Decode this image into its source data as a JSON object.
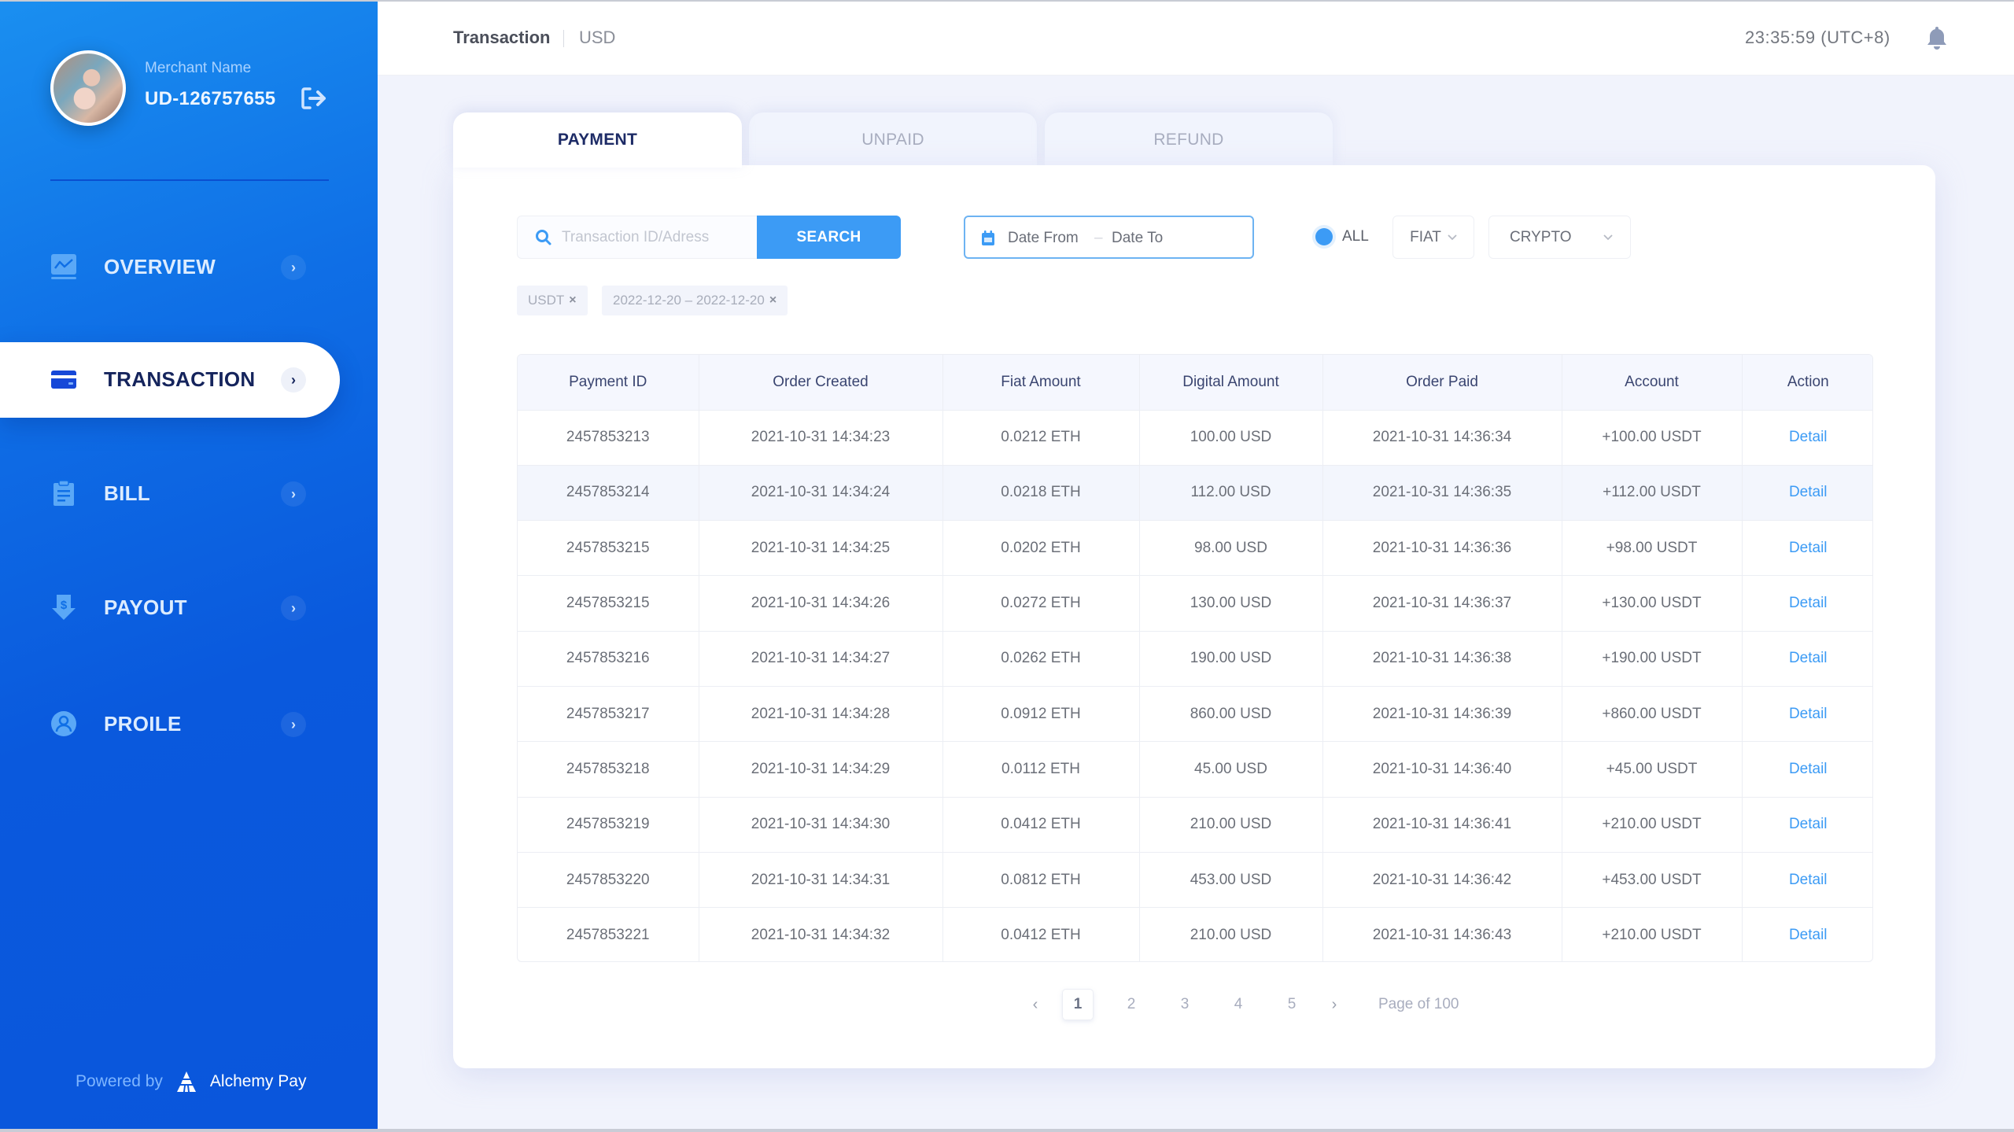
{
  "sidebar": {
    "merchant_label": "Merchant Name",
    "merchant_id": "UD-126757655",
    "items": [
      {
        "label": "OVERVIEW",
        "icon": "chart-icon",
        "active": false
      },
      {
        "label": "TRANSACTION",
        "icon": "credit-card-icon",
        "active": true
      },
      {
        "label": "BILL",
        "icon": "clipboard-icon",
        "active": false
      },
      {
        "label": "PAYOUT",
        "icon": "dollar-down-icon",
        "active": false
      },
      {
        "label": "PROILE",
        "icon": "user-circle-icon",
        "active": false
      }
    ],
    "chevron": "›",
    "powered_by": "Powered by",
    "brand": "Alchemy Pay"
  },
  "header": {
    "title": "Transaction",
    "currency": "USD",
    "time": "23:35:59 (UTC+8)"
  },
  "tabs": [
    {
      "label": "PAYMENT",
      "active": true
    },
    {
      "label": "UNPAID",
      "active": false
    },
    {
      "label": "REFUND",
      "active": false
    }
  ],
  "filters": {
    "search_placeholder": "Transaction ID/Adress",
    "search_value": "",
    "search_button": "SEARCH",
    "date_from": "Date From",
    "date_sep": "–",
    "date_to": "Date To",
    "radio_all": "ALL",
    "fiat": "FIAT",
    "crypto": "CRYPTO",
    "tags": [
      {
        "label": "USDT",
        "close": "×"
      },
      {
        "label": "2022-12-20 – 2022-12-20",
        "close": "×"
      }
    ]
  },
  "table": {
    "columns": [
      "Payment ID",
      "Order Created",
      "Fiat Amount",
      "Digital Amount",
      "Order Paid",
      "Account",
      "Action"
    ],
    "rows": [
      [
        "2457853213",
        "2021-10-31  14:34:23",
        "0.0212 ETH",
        "100.00 USD",
        "2021-10-31  14:36:34",
        "+100.00 USDT",
        "Detail"
      ],
      [
        "2457853214",
        "2021-10-31  14:34:24",
        "0.0218 ETH",
        "112.00 USD",
        "2021-10-31  14:36:35",
        "+112.00 USDT",
        "Detail"
      ],
      [
        "2457853215",
        "2021-10-31  14:34:25",
        "0.0202 ETH",
        "98.00 USD",
        "2021-10-31  14:36:36",
        "+98.00 USDT",
        "Detail"
      ],
      [
        "2457853215",
        "2021-10-31  14:34:26",
        "0.0272 ETH",
        "130.00 USD",
        "2021-10-31  14:36:37",
        "+130.00 USDT",
        "Detail"
      ],
      [
        "2457853216",
        "2021-10-31  14:34:27",
        "0.0262 ETH",
        "190.00 USD",
        "2021-10-31  14:36:38",
        "+190.00 USDT",
        "Detail"
      ],
      [
        "2457853217",
        "2021-10-31  14:34:28",
        "0.0912 ETH",
        "860.00 USD",
        "2021-10-31  14:36:39",
        "+860.00 USDT",
        "Detail"
      ],
      [
        "2457853218",
        "2021-10-31  14:34:29",
        "0.0112 ETH",
        "45.00 USD",
        "2021-10-31  14:36:40",
        "+45.00 USDT",
        "Detail"
      ],
      [
        "2457853219",
        "2021-10-31  14:34:30",
        "0.0412 ETH",
        "210.00 USD",
        "2021-10-31  14:36:41",
        "+210.00 USDT",
        "Detail"
      ],
      [
        "2457853220",
        "2021-10-31  14:34:31",
        "0.0812 ETH",
        "453.00 USD",
        "2021-10-31  14:36:42",
        "+453.00 USDT",
        "Detail"
      ],
      [
        "2457853221",
        "2021-10-31  14:34:32",
        "0.0412 ETH",
        "210.00 USD",
        "2021-10-31  14:36:43",
        "+210.00 USDT",
        "Detail"
      ]
    ],
    "highlighted_row": 1
  },
  "pagination": {
    "prev": "‹",
    "next": "›",
    "pages": [
      "1",
      "2",
      "3",
      "4",
      "5"
    ],
    "current": "1",
    "info": "Page of 100"
  },
  "colors": {
    "accent": "#3c9bf5",
    "sidebar": "#0a56dc",
    "active_text": "#15245c"
  }
}
